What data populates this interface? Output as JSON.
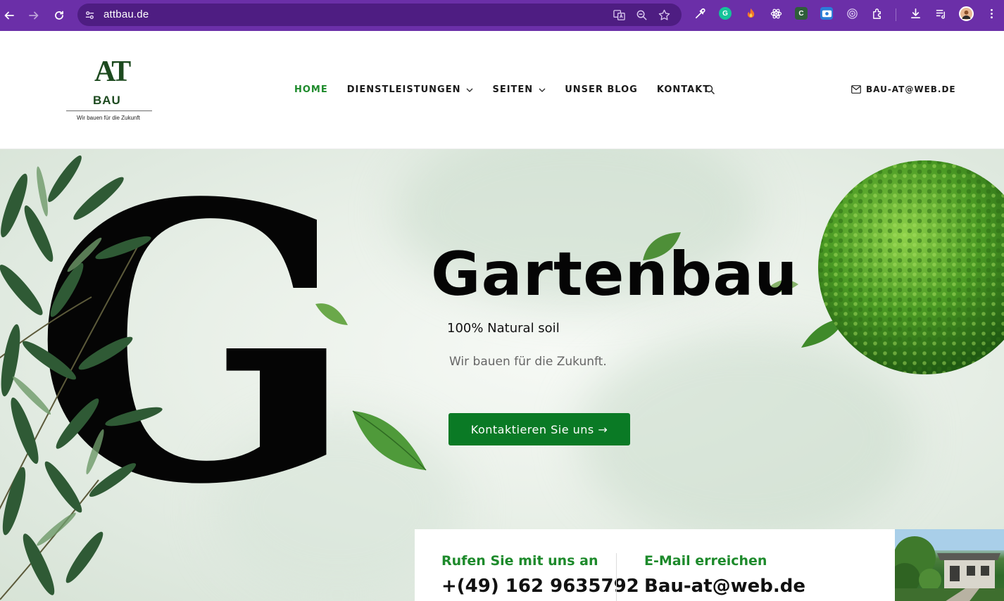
{
  "browser": {
    "url": "attbau.de"
  },
  "site": {
    "logo_mark": "AT",
    "logo_word": "BAU",
    "logo_tagline": "Wir bauen für die Zukunft",
    "nav": [
      {
        "label": "HOME",
        "active": true,
        "dropdown": false
      },
      {
        "label": "DIENSTLEISTUNGEN",
        "active": false,
        "dropdown": true
      },
      {
        "label": "SEITEN",
        "active": false,
        "dropdown": true
      },
      {
        "label": "UNSER BLOG",
        "active": false,
        "dropdown": false
      },
      {
        "label": "KONTAKT",
        "active": false,
        "dropdown": false
      }
    ],
    "header_email": "BAU-AT@WEB.DE"
  },
  "hero": {
    "letter": "G",
    "title": "Gartenbau",
    "subtitle": "100% Natural soil",
    "description": "Wir bauen für die Zukunft.",
    "cta_label": "Kontaktieren Sie uns →"
  },
  "contact": {
    "phone_heading": "Rufen Sie mit uns an",
    "phone": "+(49) 162 9635792",
    "email_heading": "E-Mail erreichen",
    "email": "Bau-at@web.de"
  },
  "colors": {
    "browser_frame": "#6b2fa8",
    "accent_green": "#1d8a2b",
    "button_green": "#0a7a25",
    "logo_green": "#1d4a1f"
  }
}
